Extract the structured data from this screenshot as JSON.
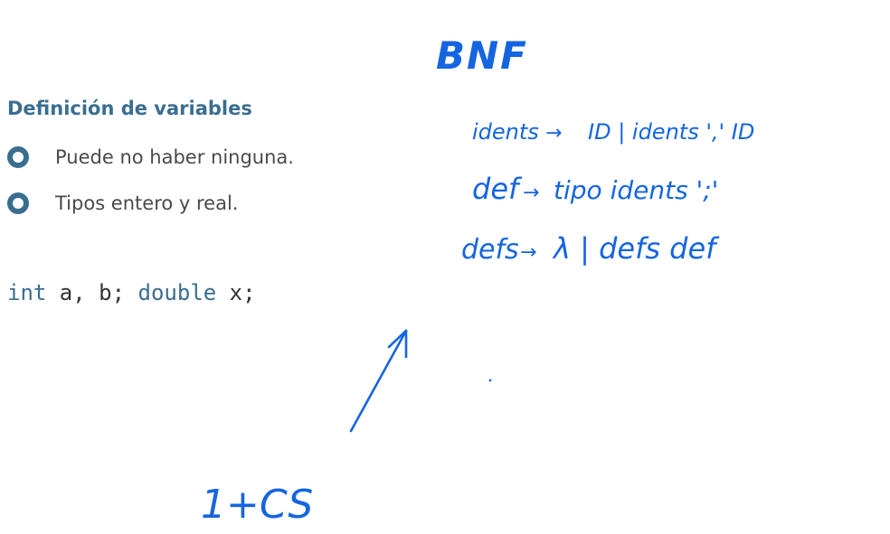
{
  "slide": {
    "heading": "Definición de variables",
    "bullets": [
      "Puede no haber ninguna.",
      "Tipos entero y real."
    ],
    "code": {
      "kw1": "int",
      "part1": " a, b; ",
      "kw2": "double",
      "part2": " x;"
    }
  },
  "annotations": {
    "title": "BNF",
    "line1_idents": "idents",
    "line1_arrow": "→",
    "line1_rest": "ID | idents ',' ID",
    "line2_def": "def",
    "line2_arrow": "→",
    "line2_rest": "tipo idents ';'",
    "line3_defs": "defs",
    "line3_arrow": "→",
    "line3_rest": "λ | defs def",
    "bottom_note": "1+CS"
  },
  "colors": {
    "accent": "#3a6e8f",
    "ink": "#1565e0",
    "text": "#4a4a4a"
  }
}
